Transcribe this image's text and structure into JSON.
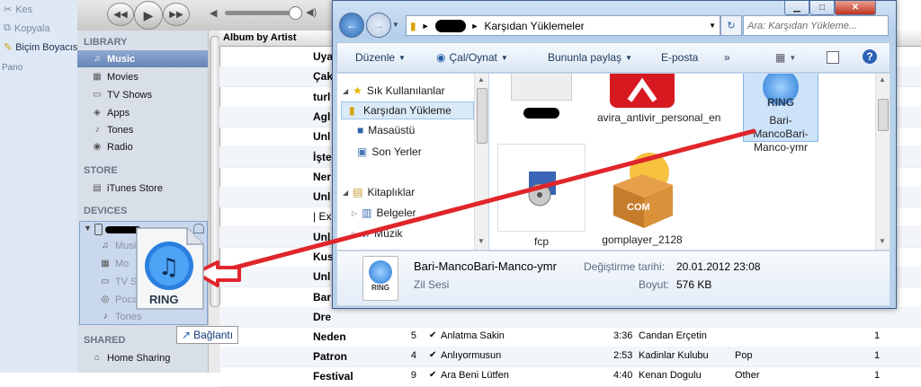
{
  "word": {
    "items": [
      "Kes",
      "Kopyala",
      "Biçim Boyacısı"
    ],
    "group": "Pano"
  },
  "itunes": {
    "sidebar": {
      "library_header": "LIBRARY",
      "library": [
        "Music",
        "Movies",
        "TV Shows",
        "Apps",
        "Tones",
        "Radio"
      ],
      "store_header": "STORE",
      "store": [
        "iTunes Store"
      ],
      "devices_header": "DEVICES",
      "device_items": [
        "Music",
        "Mo",
        "TV S",
        "Poca",
        "Tones"
      ],
      "shared_header": "SHARED",
      "shared": [
        "Home Sharing"
      ]
    },
    "list": {
      "column_header": "Album by Artist",
      "partial_albums": [
        "Uya",
        "Çak",
        "turl",
        "Agl",
        "Unl",
        "İşte",
        "Ner",
        "Unl",
        "| Ex",
        "Unl",
        "Kus",
        "Unl",
        "Bar",
        "Dre"
      ],
      "rows": [
        {
          "album": "Neden",
          "track": "5",
          "name": "Anlatma Sakin",
          "time": "3:36",
          "artist": "Candan Erçetin",
          "genre": "",
          "plays": "1"
        },
        {
          "album": "Patron",
          "track": "4",
          "name": "Anlıyormusun",
          "time": "2:53",
          "artist": "Kadinlar Kulubu",
          "genre": "Pop",
          "plays": "1"
        },
        {
          "album": "Festival",
          "track": "9",
          "name": "Ara Beni Lütfen",
          "time": "4:40",
          "artist": "Kenan Dogulu",
          "genre": "Other",
          "plays": "1"
        }
      ]
    }
  },
  "explorer": {
    "address_path": "Karşıdan Yüklemeler",
    "search_placeholder": "Ara: Karşıdan Yükleme...",
    "commands": [
      "Düzenle",
      "Çal/Oynat",
      "Bununla paylaş",
      "E-posta"
    ],
    "more": "»",
    "nav": [
      "Sık Kullanılanlar",
      "Karşıdan Yükleme",
      "Masaüstü",
      "Son Yerler",
      "Kitaplıklar",
      "Belgeler",
      "Müzik"
    ],
    "files": [
      {
        "name": "avira_antivir_personal_en"
      },
      {
        "name": "Bari-MancoBari-Manco-ymr",
        "icon_label": "RING"
      },
      {
        "name": "fcp"
      },
      {
        "name": "gomplayer_2128",
        "icon_label": "COM"
      }
    ],
    "details": {
      "filename": "Bari-MancoBari-Manco-ymr",
      "type": "Zil Sesi",
      "modified_label": "Değiştirme tarihi:",
      "modified_value": "20.01.2012 23:08",
      "size_label": "Boyut:",
      "size_value": "576 KB",
      "icon_label": "RING"
    }
  },
  "drag": {
    "icon_label": "RING",
    "badge": "Bağlantı"
  },
  "colors": {
    "arrow": "#e0262b",
    "selection": "#cde3f9",
    "itunes_sidebar": "#d9dfe8"
  }
}
